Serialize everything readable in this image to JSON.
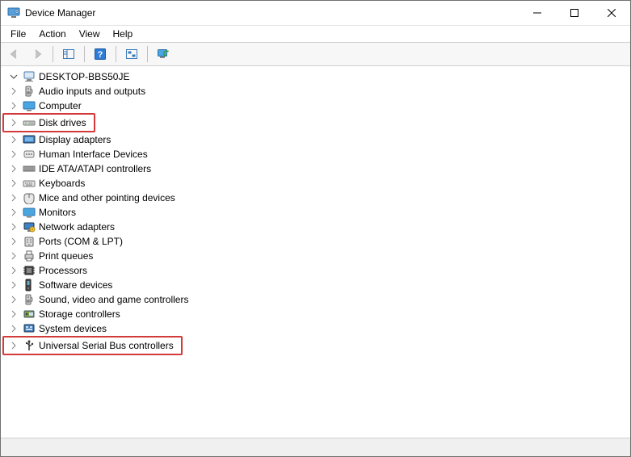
{
  "window": {
    "title": "Device Manager"
  },
  "menu": {
    "file": "File",
    "action": "Action",
    "view": "View",
    "help": "Help"
  },
  "tree": {
    "root": "DESKTOP-BBS50JE",
    "items": [
      {
        "label": "Audio inputs and outputs",
        "icon": "speaker"
      },
      {
        "label": "Computer",
        "icon": "monitor"
      },
      {
        "label": "Disk drives",
        "icon": "disk",
        "hl": true
      },
      {
        "label": "Display adapters",
        "icon": "display"
      },
      {
        "label": "Human Interface Devices",
        "icon": "hid"
      },
      {
        "label": "IDE ATA/ATAPI controllers",
        "icon": "ide"
      },
      {
        "label": "Keyboards",
        "icon": "keyboard"
      },
      {
        "label": "Mice and other pointing devices",
        "icon": "mouse"
      },
      {
        "label": "Monitors",
        "icon": "monitor"
      },
      {
        "label": "Network adapters",
        "icon": "network"
      },
      {
        "label": "Ports (COM & LPT)",
        "icon": "port"
      },
      {
        "label": "Print queues",
        "icon": "printer"
      },
      {
        "label": "Processors",
        "icon": "cpu"
      },
      {
        "label": "Software devices",
        "icon": "software"
      },
      {
        "label": "Sound, video and game controllers",
        "icon": "speaker"
      },
      {
        "label": "Storage controllers",
        "icon": "storage"
      },
      {
        "label": "System devices",
        "icon": "system"
      },
      {
        "label": "Universal Serial Bus controllers",
        "icon": "usb",
        "hl": true
      }
    ]
  }
}
